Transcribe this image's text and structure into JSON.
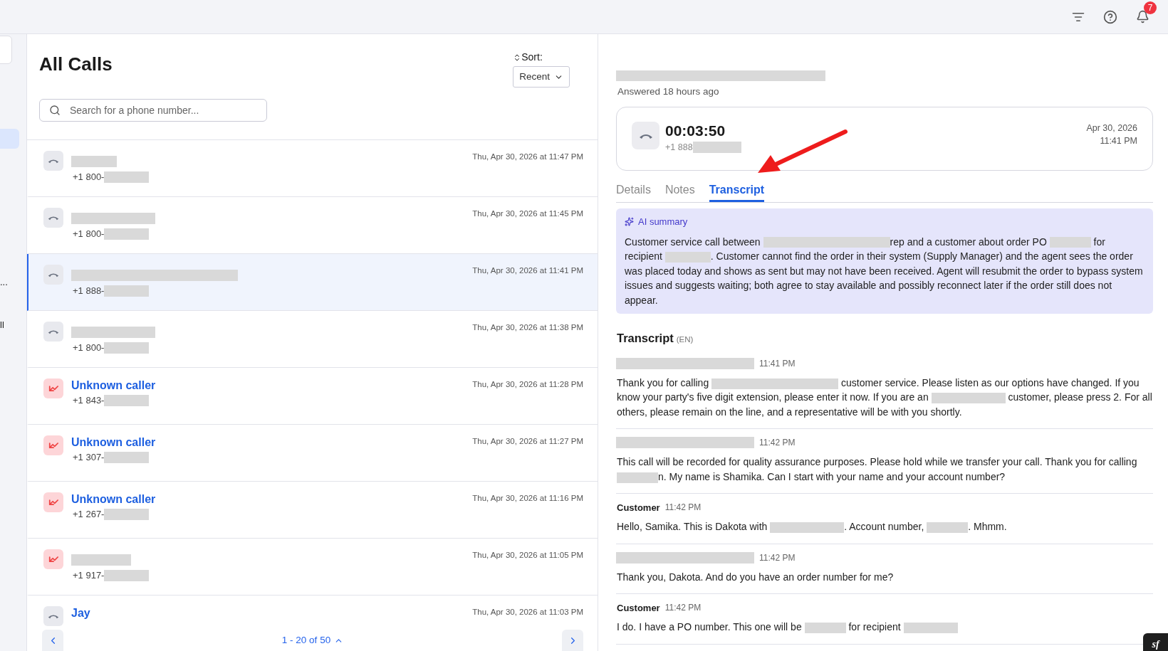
{
  "top_bar": {
    "notification_count": "7"
  },
  "sidebar": {
    "fragments": [
      "...",
      "ll"
    ]
  },
  "call_list": {
    "title": "All Calls",
    "sort": {
      "label": "Sort:",
      "value": "Recent"
    },
    "search": {
      "placeholder": "Search for a phone number..."
    },
    "rows": [
      {
        "kind": "answered",
        "selected": false,
        "name": {
          "kind": "redacted"
        },
        "phone": {
          "prefix": "+1 800-"
        },
        "date": "Thu, Apr 30, 2026 at 11:47 PM"
      },
      {
        "kind": "answered",
        "selected": false,
        "name": {
          "kind": "redacted"
        },
        "phone": {
          "prefix": "+1 800-"
        },
        "date": "Thu, Apr 30, 2026 at 11:45 PM"
      },
      {
        "kind": "answered",
        "selected": true,
        "name": {
          "kind": "redacted"
        },
        "phone": {
          "prefix": "+1 888-"
        },
        "date": "Thu, Apr 30, 2026 at 11:41 PM"
      },
      {
        "kind": "answered",
        "selected": false,
        "name": {
          "kind": "redacted"
        },
        "phone": {
          "prefix": "+1 800-"
        },
        "date": "Thu, Apr 30, 2026 at 11:38 PM"
      },
      {
        "kind": "missed",
        "selected": false,
        "name": {
          "kind": "text",
          "text": "Unknown caller"
        },
        "phone": {
          "prefix": "+1 843-"
        },
        "date": "Thu, Apr 30, 2026 at 11:28 PM"
      },
      {
        "kind": "missed",
        "selected": false,
        "name": {
          "kind": "text",
          "text": "Unknown caller"
        },
        "phone": {
          "prefix": "+1 307-"
        },
        "date": "Thu, Apr 30, 2026 at 11:27 PM"
      },
      {
        "kind": "missed",
        "selected": false,
        "name": {
          "kind": "text",
          "text": "Unknown caller"
        },
        "phone": {
          "prefix": "+1 267-"
        },
        "date": "Thu, Apr 30, 2026 at 11:16 PM"
      },
      {
        "kind": "missed",
        "selected": false,
        "name": {
          "kind": "redacted"
        },
        "phone": {
          "prefix": "+1 917-"
        },
        "date": "Thu, Apr 30, 2026 at 11:05 PM"
      },
      {
        "kind": "answered",
        "selected": false,
        "name": {
          "kind": "text",
          "text": "Jay"
        },
        "date": "Thu, Apr 30, 2026 at 11:03 PM"
      }
    ],
    "pagination": {
      "label": "1 - 20 of 50"
    }
  },
  "detail": {
    "status": "Answered 18 hours ago",
    "call_card": {
      "duration": "00:03:50",
      "phone_prefix": "+1 888",
      "date": "Apr 30, 2026",
      "time": "11:41 PM"
    },
    "tabs": [
      {
        "label": "Details",
        "selected": false
      },
      {
        "label": "Notes",
        "selected": false
      },
      {
        "label": "Transcript",
        "selected": true
      }
    ],
    "ai_summary": {
      "title": "AI summary",
      "parts": [
        {
          "kind": "text",
          "text": "Customer service call between "
        },
        {
          "kind": "redacted"
        },
        {
          "kind": "text",
          "text": "rep and a customer about order PO "
        },
        {
          "kind": "redacted"
        },
        {
          "kind": "text",
          "text": " for recipient "
        },
        {
          "kind": "redacted"
        },
        {
          "kind": "text",
          "text": ". Customer cannot find the order in their system (Supply Manager) and the agent sees the order was placed today and shows as sent but may not have been received. Agent will resubmit the order to bypass system issues and suggests waiting; both agree to stay available and possibly reconnect later if the order still does not appear."
        }
      ]
    },
    "transcript": {
      "title": "Transcript",
      "language": "(EN)",
      "entries": [
        {
          "speaker": {
            "kind": "redacted"
          },
          "time": "11:41 PM",
          "parts": [
            {
              "kind": "text",
              "text": "Thank you for calling "
            },
            {
              "kind": "redacted"
            },
            {
              "kind": "text",
              "text": " customer service. Please listen as our options have changed. If you know your party's five digit extension, please enter it now. If you are an "
            },
            {
              "kind": "redacted"
            },
            {
              "kind": "text",
              "text": " customer, please press 2. For all others, please remain on the line, and a representative will be with you shortly."
            }
          ]
        },
        {
          "speaker": {
            "kind": "redacted"
          },
          "time": "11:42 PM",
          "parts": [
            {
              "kind": "text",
              "text": "This call will be recorded for quality assurance purposes. Please hold while we transfer your call. Thank you for calling "
            },
            {
              "kind": "redacted"
            },
            {
              "kind": "text",
              "text": "n. My name is Shamika. Can I start with your name and your account number?"
            }
          ]
        },
        {
          "speaker": {
            "kind": "text",
            "text": "Customer"
          },
          "time": "11:42 PM",
          "parts": [
            {
              "kind": "text",
              "text": "Hello, Samika. This is Dakota with "
            },
            {
              "kind": "redacted"
            },
            {
              "kind": "text",
              "text": ". Account number, "
            },
            {
              "kind": "redacted"
            },
            {
              "kind": "text",
              "text": ". Mhmm."
            }
          ]
        },
        {
          "speaker": {
            "kind": "redacted"
          },
          "time": "11:42 PM",
          "parts": [
            {
              "kind": "text",
              "text": "Thank you, Dakota. And do you have an order number for me?"
            }
          ]
        },
        {
          "speaker": {
            "kind": "text",
            "text": "Customer"
          },
          "time": "11:42 PM",
          "parts": [
            {
              "kind": "text",
              "text": "I do. I have a PO number. This one will be "
            },
            {
              "kind": "redacted"
            },
            {
              "kind": "text",
              "text": " for recipient "
            },
            {
              "kind": "redacted"
            }
          ]
        }
      ]
    }
  },
  "debug_badge": {
    "label": "sf"
  }
}
